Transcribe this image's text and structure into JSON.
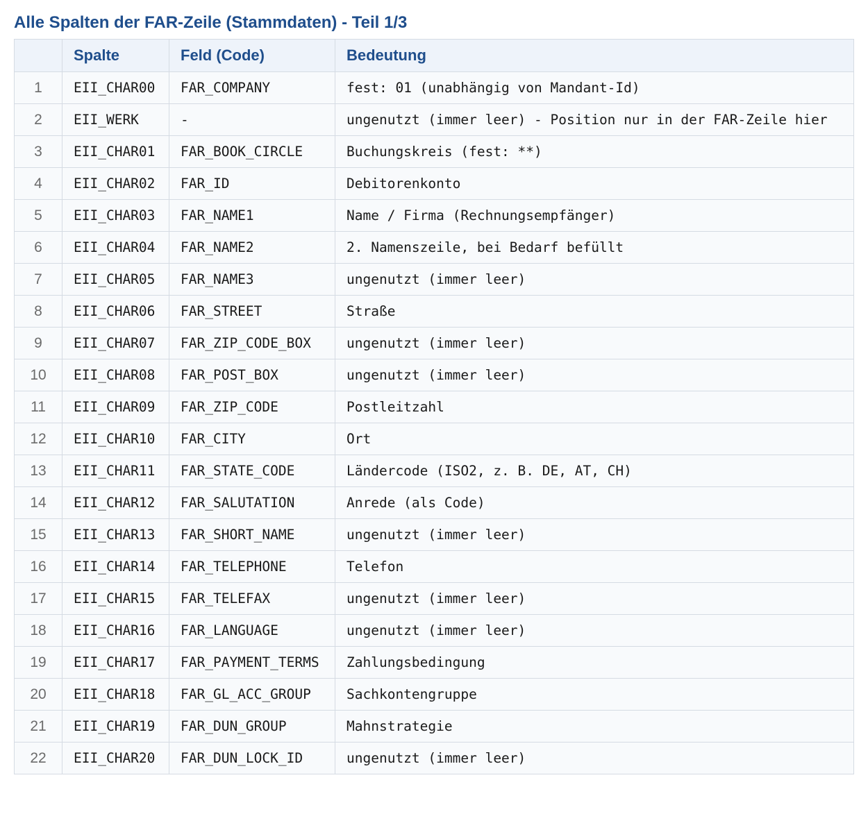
{
  "title": "Alle Spalten der FAR-Zeile (Stammdaten) - Teil 1/3",
  "table": {
    "headers": [
      "",
      "Spalte",
      "Feld (Code)",
      "Bedeutung"
    ],
    "rows": [
      {
        "num": "1",
        "spalte": "EII_CHAR00",
        "feld": "FAR_COMPANY",
        "bedeutung": "fest: 01 (unabhängig von Mandant-Id)"
      },
      {
        "num": "2",
        "spalte": "EII_WERK",
        "feld": "-",
        "bedeutung": "ungenutzt (immer leer) - Position nur in der FAR-Zeile hier"
      },
      {
        "num": "3",
        "spalte": "EII_CHAR01",
        "feld": "FAR_BOOK_CIRCLE",
        "bedeutung": "Buchungskreis (fest: **)"
      },
      {
        "num": "4",
        "spalte": "EII_CHAR02",
        "feld": "FAR_ID",
        "bedeutung": "Debitorenkonto"
      },
      {
        "num": "5",
        "spalte": "EII_CHAR03",
        "feld": "FAR_NAME1",
        "bedeutung": "Name / Firma (Rechnungsempfänger)"
      },
      {
        "num": "6",
        "spalte": "EII_CHAR04",
        "feld": "FAR_NAME2",
        "bedeutung": "2. Namenszeile, bei Bedarf befüllt"
      },
      {
        "num": "7",
        "spalte": "EII_CHAR05",
        "feld": "FAR_NAME3",
        "bedeutung": "ungenutzt (immer leer)"
      },
      {
        "num": "8",
        "spalte": "EII_CHAR06",
        "feld": "FAR_STREET",
        "bedeutung": "Straße"
      },
      {
        "num": "9",
        "spalte": "EII_CHAR07",
        "feld": "FAR_ZIP_CODE_BOX",
        "bedeutung": "ungenutzt (immer leer)"
      },
      {
        "num": "10",
        "spalte": "EII_CHAR08",
        "feld": "FAR_POST_BOX",
        "bedeutung": "ungenutzt (immer leer)"
      },
      {
        "num": "11",
        "spalte": "EII_CHAR09",
        "feld": "FAR_ZIP_CODE",
        "bedeutung": "Postleitzahl"
      },
      {
        "num": "12",
        "spalte": "EII_CHAR10",
        "feld": "FAR_CITY",
        "bedeutung": "Ort"
      },
      {
        "num": "13",
        "spalte": "EII_CHAR11",
        "feld": "FAR_STATE_CODE",
        "bedeutung": "Ländercode (ISO2, z. B. DE, AT, CH)"
      },
      {
        "num": "14",
        "spalte": "EII_CHAR12",
        "feld": "FAR_SALUTATION",
        "bedeutung": "Anrede (als Code)"
      },
      {
        "num": "15",
        "spalte": "EII_CHAR13",
        "feld": "FAR_SHORT_NAME",
        "bedeutung": "ungenutzt (immer leer)"
      },
      {
        "num": "16",
        "spalte": "EII_CHAR14",
        "feld": "FAR_TELEPHONE",
        "bedeutung": "Telefon"
      },
      {
        "num": "17",
        "spalte": "EII_CHAR15",
        "feld": "FAR_TELEFAX",
        "bedeutung": "ungenutzt (immer leer)"
      },
      {
        "num": "18",
        "spalte": "EII_CHAR16",
        "feld": "FAR_LANGUAGE",
        "bedeutung": "ungenutzt (immer leer)"
      },
      {
        "num": "19",
        "spalte": "EII_CHAR17",
        "feld": "FAR_PAYMENT_TERMS",
        "bedeutung": "Zahlungsbedingung"
      },
      {
        "num": "20",
        "spalte": "EII_CHAR18",
        "feld": "FAR_GL_ACC_GROUP",
        "bedeutung": "Sachkontengruppe"
      },
      {
        "num": "21",
        "spalte": "EII_CHAR19",
        "feld": "FAR_DUN_GROUP",
        "bedeutung": "Mahnstrategie"
      },
      {
        "num": "22",
        "spalte": "EII_CHAR20",
        "feld": "FAR_DUN_LOCK_ID",
        "bedeutung": "ungenutzt (immer leer)"
      }
    ]
  },
  "colors": {
    "title": "#1f4e8c",
    "header_text": "#1f4e8c",
    "header_bg": "#eef3fa",
    "row_bg": "#f8fafc",
    "border": "#d5dbe3",
    "row_number": "#6b6b6b"
  }
}
